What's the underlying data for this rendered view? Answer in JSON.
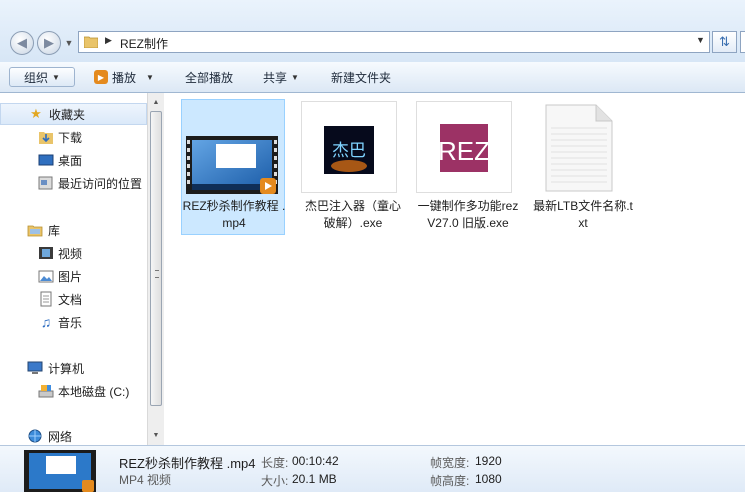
{
  "address_bar": {
    "path_segment": "REZ制作",
    "back_icon": "back-arrow-icon",
    "forward_icon": "forward-arrow-icon",
    "refresh_icon": "refresh-icon"
  },
  "toolbar": {
    "organize": "组织",
    "play": "播放",
    "play_all": "全部播放",
    "share": "共享",
    "new_folder": "新建文件夹"
  },
  "nav": {
    "favorites": "收藏夹",
    "downloads": "下载",
    "desktop": "桌面",
    "recent": "最近访问的位置",
    "libraries": "库",
    "videos": "视频",
    "pictures": "图片",
    "documents": "文档",
    "music": "音乐",
    "computer": "计算机",
    "local_disk": "本地磁盘 (C:)",
    "network": "网络"
  },
  "files": [
    {
      "name": "REZ秒杀制作教程 .mp4",
      "type": "video",
      "selected": true
    },
    {
      "name": "杰巴注入器（童心破解）.exe",
      "type": "exe",
      "icon_text": "杰巴"
    },
    {
      "name": "一键制作多功能rez V27.0  旧版.exe",
      "type": "exe",
      "icon_text": "REZ"
    },
    {
      "name": "最新LTB文件名称.txt",
      "type": "txt"
    }
  ],
  "details": {
    "name": "REZ秒杀制作教程 .mp4",
    "type": "MP4 视频",
    "length_label": "长度:",
    "length_value": "00:10:42",
    "size_label": "大小:",
    "size_value": "20.1 MB",
    "width_label": "帧宽度:",
    "width_value": "1920",
    "height_label": "帧高度:",
    "height_value": "1080"
  },
  "colors": {
    "selection": "#cce8ff",
    "toolbar_bg": "#dce8f5",
    "accent_orange": "#e48a1e"
  }
}
